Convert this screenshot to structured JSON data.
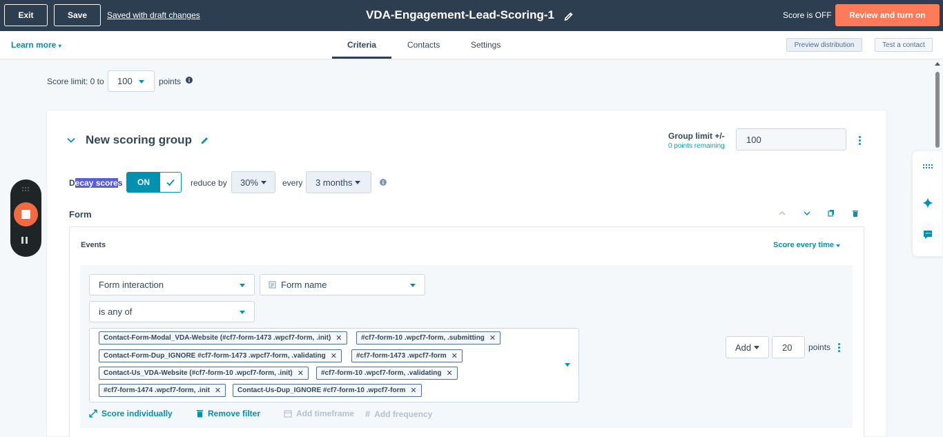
{
  "topbar": {
    "exit_label": "Exit",
    "save_label": "Save",
    "draft_status": "Saved with draft changes",
    "title": "VDA-Engagement-Lead-Scoring-1",
    "score_status": "Score is OFF",
    "review_label": "Review and turn on"
  },
  "tabbar": {
    "learn_more": "Learn more",
    "tabs": [
      {
        "label": "Criteria",
        "active": true
      },
      {
        "label": "Contacts",
        "active": false
      },
      {
        "label": "Settings",
        "active": false
      }
    ],
    "preview_label": "Preview distribution",
    "test_label": "Test a contact"
  },
  "score_limit": {
    "label": "Score limit: 0 to",
    "value": "100",
    "unit": "points"
  },
  "group": {
    "title": "New scoring group",
    "limit_label": "Group limit +/-",
    "points_remaining": "0 points remaining",
    "limit_value": "100",
    "decay": {
      "label_pre": "D",
      "label_highlight": "ecay score",
      "label_post": "s",
      "toggle_label": "ON",
      "reduce_label": "reduce by",
      "reduce_value": "30%",
      "every_label": "every",
      "every_value": "3 months"
    }
  },
  "form_section": {
    "title": "Form",
    "events_label": "Events",
    "score_every": "Score every time",
    "event_type": "Form interaction",
    "property": "Form name",
    "operator": "is any of",
    "values": [
      "Contact-Form-Modal_VDA-Website (#cf7-form-1473 .wpcf7-form, .init)",
      "#cf7-form-10 .wpcf7-form, .submitting",
      "Contact-Form-Dup_IGNORE #cf7-form-1473 .wpcf7-form, .validating",
      "#cf7-form-1473 .wpcf7-form",
      "Contact-Us_VDA-Website (#cf7-form-10 .wpcf7-form, .init)",
      "#cf7-form-10 .wpcf7-form, .validating",
      "#cf7-form-1474 .wpcf7-form, .init",
      "Contact-Us-Dup_IGNORE #cf7-form-10 .wpcf7-form"
    ],
    "add_label": "Add",
    "points_value": "20",
    "points_label": "points",
    "actions": {
      "score_individually": "Score individually",
      "remove_filter": "Remove filter",
      "add_timeframe": "Add timeframe",
      "add_frequency": "Add frequency"
    }
  },
  "colors": {
    "topbar_bg": "#2d3e50",
    "accent": "#0091ae",
    "cta": "#ff7a59",
    "recorder_stop": "#f26a42",
    "selection_highlight": "#5a5fd6"
  }
}
